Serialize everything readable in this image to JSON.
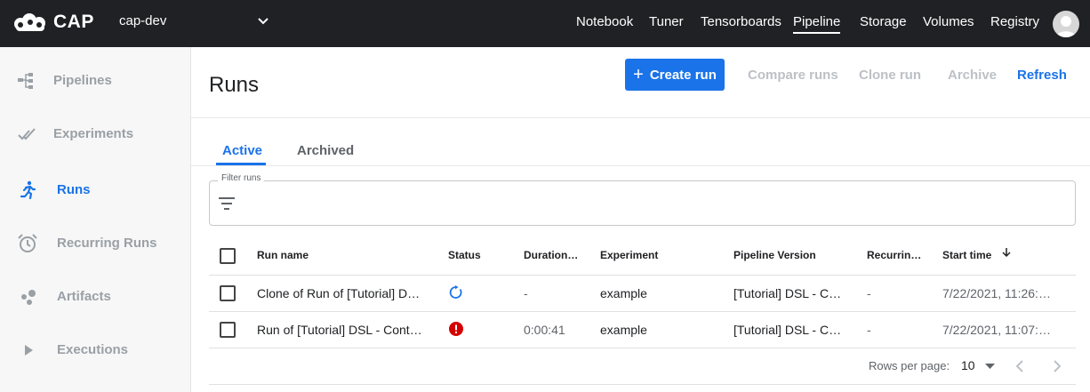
{
  "app": {
    "brand": "CAP",
    "namespace": "cap-dev"
  },
  "topnav": [
    "Notebook",
    "Tuner",
    "Tensorboards",
    "Pipeline",
    "Storage",
    "Volumes",
    "Registry"
  ],
  "topnav_active": "Pipeline",
  "sidebar": {
    "items": [
      {
        "label": "Pipelines",
        "icon": "pipelines-icon"
      },
      {
        "label": "Experiments",
        "icon": "experiments-icon"
      },
      {
        "label": "Runs",
        "icon": "runs-icon",
        "active": true
      },
      {
        "label": "Recurring Runs",
        "icon": "alarm-clock-icon"
      },
      {
        "label": "Artifacts",
        "icon": "artifacts-icon"
      },
      {
        "label": "Executions",
        "icon": "play-icon"
      }
    ]
  },
  "page": {
    "title": "Runs",
    "actions": {
      "create_run": "Create run",
      "compare_runs": "Compare runs",
      "clone_run": "Clone run",
      "archive": "Archive",
      "refresh": "Refresh"
    },
    "tabs": {
      "active": "Active",
      "archived": "Archived"
    },
    "filter": {
      "label": "Filter runs",
      "value": ""
    }
  },
  "table": {
    "columns": {
      "run_name": "Run name",
      "status": "Status",
      "duration": "Duration…",
      "experiment": "Experiment",
      "pipeline_version": "Pipeline Version",
      "recurring": "Recurrin…",
      "start_time": "Start time"
    },
    "rows": [
      {
        "run_name": "Clone of Run of [Tutorial] D…",
        "status": "running",
        "duration": "-",
        "experiment": "example",
        "pipeline_version": "[Tutorial] DSL - C…",
        "recurring": "-",
        "start_time": "7/22/2021, 11:26:…"
      },
      {
        "run_name": "Run of [Tutorial] DSL - Cont…",
        "status": "error",
        "duration": "0:00:41",
        "experiment": "example",
        "pipeline_version": "[Tutorial] DSL - C…",
        "recurring": "-",
        "start_time": "7/22/2021, 11:07:…"
      }
    ]
  },
  "pagination": {
    "rows_per_page_label": "Rows per page:",
    "rows_per_page": "10"
  },
  "colors": {
    "accent": "#1a73e8",
    "topbar": "#1f2124",
    "error": "#d50000",
    "disabled": "#bdc1c6"
  }
}
